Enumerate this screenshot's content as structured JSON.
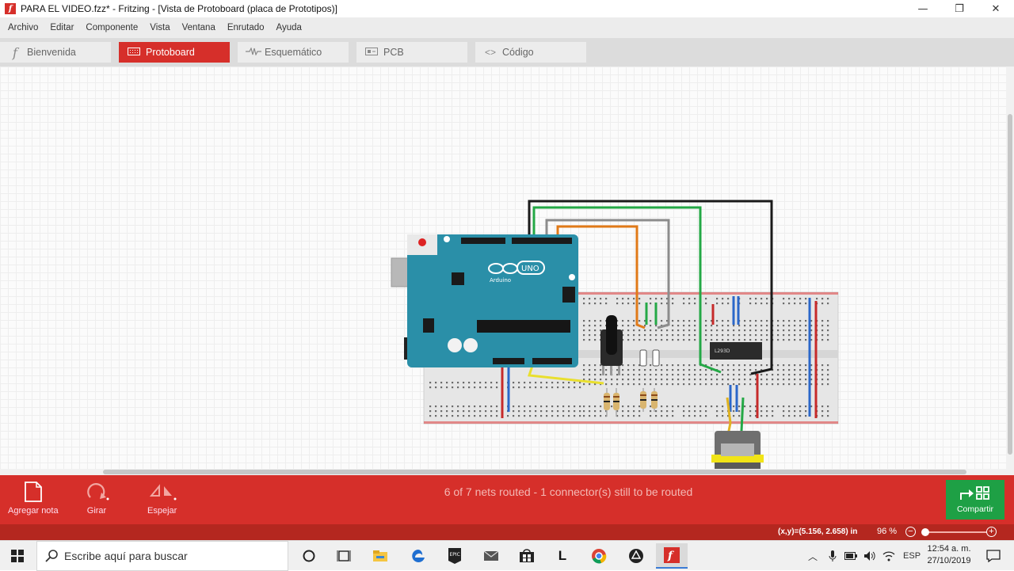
{
  "window": {
    "title": "PARA EL VIDEO.fzz* - Fritzing - [Vista de Protoboard (placa de Prototipos)]",
    "minimize": "—",
    "restore": "❐",
    "close": "✕"
  },
  "menu": [
    "Archivo",
    "Editar",
    "Componente",
    "Vista",
    "Ventana",
    "Enrutado",
    "Ayuda"
  ],
  "tabs": [
    {
      "label": "Bienvenida",
      "icon": "fritzing-f-icon",
      "active": false
    },
    {
      "label": "Protoboard",
      "icon": "breadboard-icon",
      "active": true
    },
    {
      "label": "Esquemático",
      "icon": "schematic-icon",
      "active": false
    },
    {
      "label": "PCB",
      "icon": "pcb-icon",
      "active": false
    },
    {
      "label": "Código",
      "icon": "code-icon",
      "active": false
    }
  ],
  "canvas": {
    "logo": "fritzing",
    "arduino_brand": "Arduino",
    "arduino_model": "UNO",
    "chip_label": "L293D"
  },
  "toolbar": {
    "note_label": "Agregar nota",
    "rotate_label": "Girar",
    "mirror_label": "Espejar",
    "routing_status": "6 of 7 nets routed - 1 connector(s) still to be routed",
    "share_label": "Compartir"
  },
  "status": {
    "coords": "(x,y)=(5.156, 2.658) in",
    "zoom": "96 %"
  },
  "taskbar": {
    "search_placeholder": "Escribe aquí para buscar",
    "language": "ESP",
    "time": "12:54 a. m.",
    "date": "27/10/2019",
    "l_app": "L",
    "epic_app": "EPIC"
  },
  "colors": {
    "accent": "#d62f2a",
    "share": "#1ea045",
    "arduino": "#2a8fa8"
  }
}
